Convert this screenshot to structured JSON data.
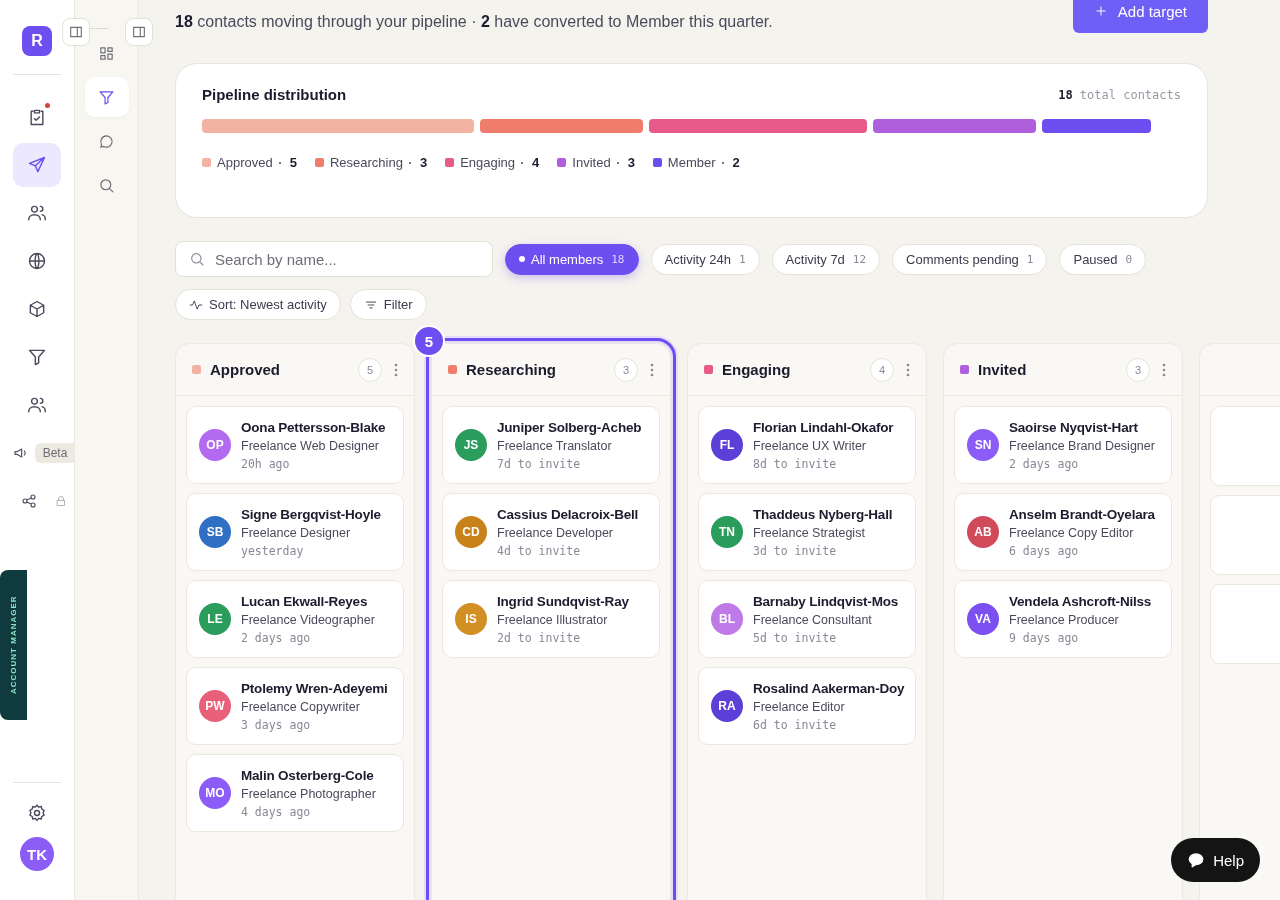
{
  "rail": {
    "logo": "R",
    "items": [
      {
        "selected": false,
        "notification": true
      },
      {
        "selected": true,
        "notification": false
      },
      {
        "selected": false,
        "notification": false
      },
      {
        "selected": false,
        "notification": false
      },
      {
        "selected": false,
        "notification": false
      },
      {
        "selected": false,
        "notification": false
      },
      {
        "selected": false,
        "notification": false
      },
      {
        "selected": false,
        "notification": false,
        "badge": "Beta"
      },
      {
        "selected": false,
        "notification": false,
        "locked": true
      }
    ],
    "account_manager": "ACCOUNT MANAGER",
    "avatar": "TK"
  },
  "subnav": {
    "items": [
      {
        "selected": false
      },
      {
        "selected": true
      },
      {
        "selected": false
      },
      {
        "selected": false
      }
    ]
  },
  "header": {
    "subtitle": "**18** contacts moving through your pipeline · **2** have converted to Member this quarter.",
    "add_button": "Add target"
  },
  "distribution": {
    "title": "Pipeline distribution",
    "total": "18",
    "total_label": "total contacts",
    "stages": [
      {
        "name": "Approved",
        "count": "5",
        "color": "#f2b3a3"
      },
      {
        "name": "Researching",
        "count": "3",
        "color": "#f07c6c"
      },
      {
        "name": "Engaging",
        "count": "4",
        "color": "#e85a8a"
      },
      {
        "name": "Invited",
        "count": "3",
        "color": "#b05fdc"
      },
      {
        "name": "Member",
        "count": "2",
        "color": "#6d4ef0"
      }
    ]
  },
  "search": {
    "placeholder": "Search by name..."
  },
  "filters": [
    {
      "label": "All members",
      "count": "18",
      "selected": true
    },
    {
      "label": "Activity 24h",
      "count": "1",
      "selected": false
    },
    {
      "label": "Activity 7d",
      "count": "12",
      "selected": false
    },
    {
      "label": "Comments pending",
      "count": "1",
      "selected": false
    },
    {
      "label": "Paused",
      "count": "0",
      "selected": false
    }
  ],
  "sort_button": "Sort: Newest activity",
  "filter_button": "Filter",
  "columns": [
    {
      "title": "Approved",
      "count": "5",
      "color": "#f2b3a3",
      "selected": false,
      "cards": [
        {
          "initials": "OP",
          "name": "Oona Pettersson-Blake",
          "role": "Freelance Web Designer",
          "time": "20h ago",
          "color": "#b26af0"
        },
        {
          "initials": "SB",
          "name": "Signe Bergqvist-Hoyle",
          "role": "Freelance Designer",
          "time": "yesterday",
          "color": "#2f6fc4"
        },
        {
          "initials": "LE",
          "name": "Lucan Ekwall-Reyes",
          "role": "Freelance Videographer",
          "time": "2 days ago",
          "color": "#2a9d5c"
        },
        {
          "initials": "PW",
          "name": "Ptolemy Wren-Adeyemi",
          "role": "Freelance Copywriter",
          "time": "3 days ago",
          "color": "#e8607a"
        },
        {
          "initials": "MO",
          "name": "Malin Osterberg-Cole",
          "role": "Freelance Photographer",
          "time": "4 days ago",
          "color": "#8b5cf6"
        }
      ]
    },
    {
      "title": "Researching",
      "count": "3",
      "color": "#f07c6c",
      "selected": true,
      "badge": "5",
      "cards": [
        {
          "initials": "JS",
          "name": "Juniper Solberg-Acheb",
          "role": "Freelance Translator",
          "time": "7d to invite",
          "color": "#2a9d5c"
        },
        {
          "initials": "CD",
          "name": "Cassius Delacroix-Bell",
          "role": "Freelance Developer",
          "time": "4d to invite",
          "color": "#c9821a"
        },
        {
          "initials": "IS",
          "name": "Ingrid Sundqvist-Ray",
          "role": "Freelance Illustrator",
          "time": "2d to invite",
          "color": "#d18f24"
        }
      ]
    },
    {
      "title": "Engaging",
      "count": "4",
      "color": "#e85a8a",
      "selected": false,
      "cards": [
        {
          "initials": "FL",
          "name": "Florian Lindahl-Okafor",
          "role": "Freelance UX Writer",
          "time": "8d to invite",
          "color": "#5b3fd6"
        },
        {
          "initials": "TN",
          "name": "Thaddeus Nyberg-Hall",
          "role": "Freelance Strategist",
          "time": "3d to invite",
          "color": "#2a9d5c"
        },
        {
          "initials": "BL",
          "name": "Barnaby Lindqvist-Mos",
          "role": "Freelance Consultant",
          "time": "5d to invite",
          "color": "#c07ae8"
        },
        {
          "initials": "RA",
          "name": "Rosalind Aakerman-Doy",
          "role": "Freelance Editor",
          "time": "6d to invite",
          "color": "#5b3fd6"
        }
      ]
    },
    {
      "title": "Invited",
      "count": "3",
      "color": "#b05fdc",
      "selected": false,
      "cards": [
        {
          "initials": "SN",
          "name": "Saoirse Nyqvist-Hart",
          "role": "Freelance Brand Designer",
          "time": "2 days ago",
          "color": "#8b5cf6"
        },
        {
          "initials": "AB",
          "name": "Anselm Brandt-Oyelara",
          "role": "Freelance Copy Editor",
          "time": "6 days ago",
          "color": "#d04a5a"
        },
        {
          "initials": "VA",
          "name": "Vendela Ashcroft-Nilss",
          "role": "Freelance Producer",
          "time": "9 days ago",
          "color": "#7c4ff0"
        }
      ]
    }
  ],
  "help_button": "Help"
}
